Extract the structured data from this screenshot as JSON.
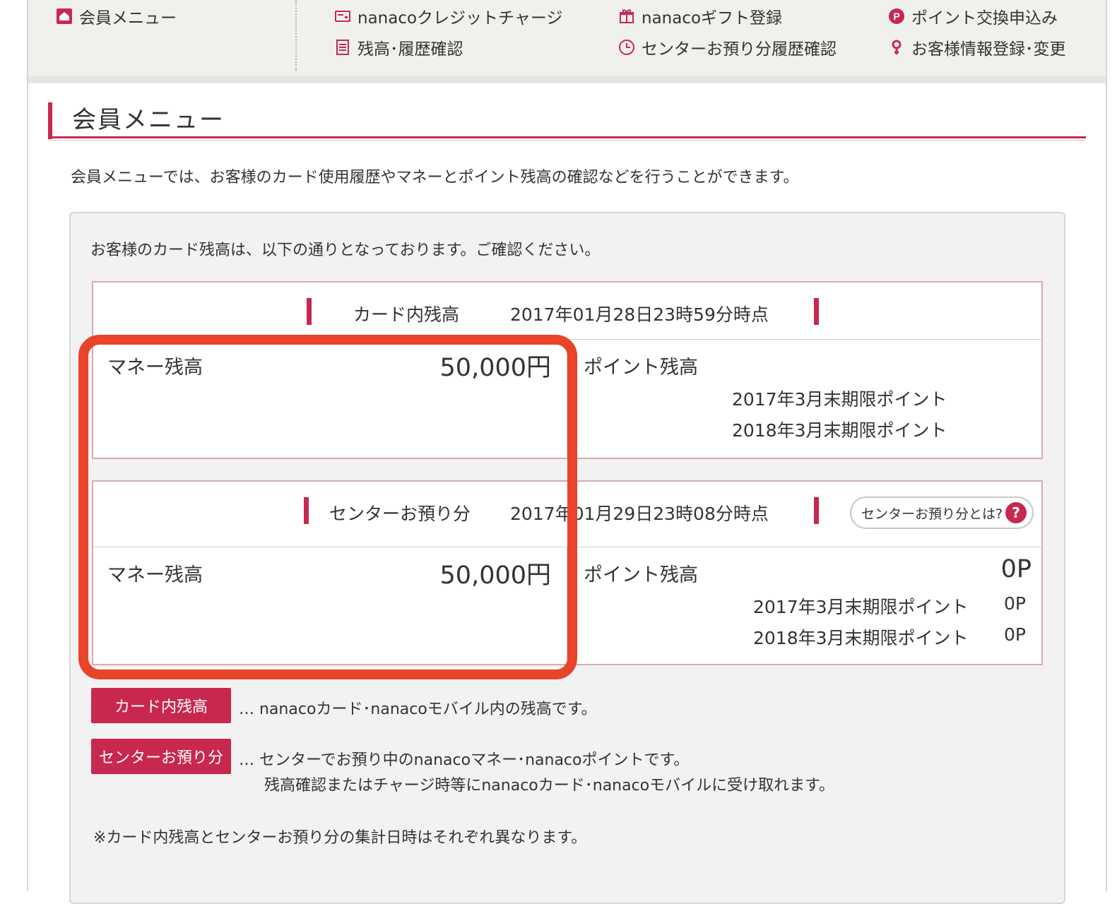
{
  "nav": {
    "member_menu": "会員メニュー",
    "items": [
      {
        "label": "nanacoクレジットチャージ",
        "icon": "credit-charge-icon"
      },
      {
        "label": "nanacoギフト登録",
        "icon": "gift-icon"
      },
      {
        "label": "ポイント交換申込み",
        "icon": "point-p-icon"
      },
      {
        "label": "残高･履歴確認",
        "icon": "list-document-icon"
      },
      {
        "label": "センターお預り分履歴確認",
        "icon": "clock-icon"
      },
      {
        "label": "お客様情報登録･変更",
        "icon": "person-pin-icon"
      }
    ]
  },
  "page": {
    "title": "会員メニュー",
    "intro": "会員メニューでは、お客様のカード使用履歴やマネーとポイント残高の確認などを行うことができます。",
    "lead": "お客様のカード残高は、以下の通りとなっております。ご確認ください。"
  },
  "card_balance": {
    "heading": "カード内残高",
    "datetime": "2017年01月28日23時59分時点",
    "money_label": "マネー残高",
    "money_value": "50,000円",
    "point_label": "ポイント残高",
    "point_value": "",
    "sub": [
      {
        "label": "2017年3月末期限ポイント",
        "value": ""
      },
      {
        "label": "2018年3月末期限ポイント",
        "value": ""
      }
    ]
  },
  "center_balance": {
    "heading": "センターお預り分",
    "datetime": "2017年01月29日23時08分時点",
    "help_button": "センターお預り分とは?",
    "help_mark": "?",
    "money_label": "マネー残高",
    "money_value": "50,000円",
    "point_label": "ポイント残高",
    "point_value": "0P",
    "sub": [
      {
        "label": "2017年3月末期限ポイント",
        "value": "0P"
      },
      {
        "label": "2018年3月末期限ポイント",
        "value": "0P"
      }
    ]
  },
  "legend": {
    "card_tag": "カード内残高",
    "card_text": "… nanacoカード･nanacoモバイル内の残高です。",
    "center_tag": "センターお預り分",
    "center_text_1": "… センターでお預り中のnanacoマネー･nanacoポイントです。",
    "center_text_2": "残高確認またはチャージ時等にnanacoカード･nanacoモバイルに受け取れます。",
    "note": "※カード内残高とセンターお預り分の集計日時はそれぞれ異なります。"
  },
  "colors": {
    "brand": "#c8284e",
    "highlight": "#e8442a",
    "panel_bg": "#f2f2f2",
    "nav_bg": "#f0f0ec"
  }
}
